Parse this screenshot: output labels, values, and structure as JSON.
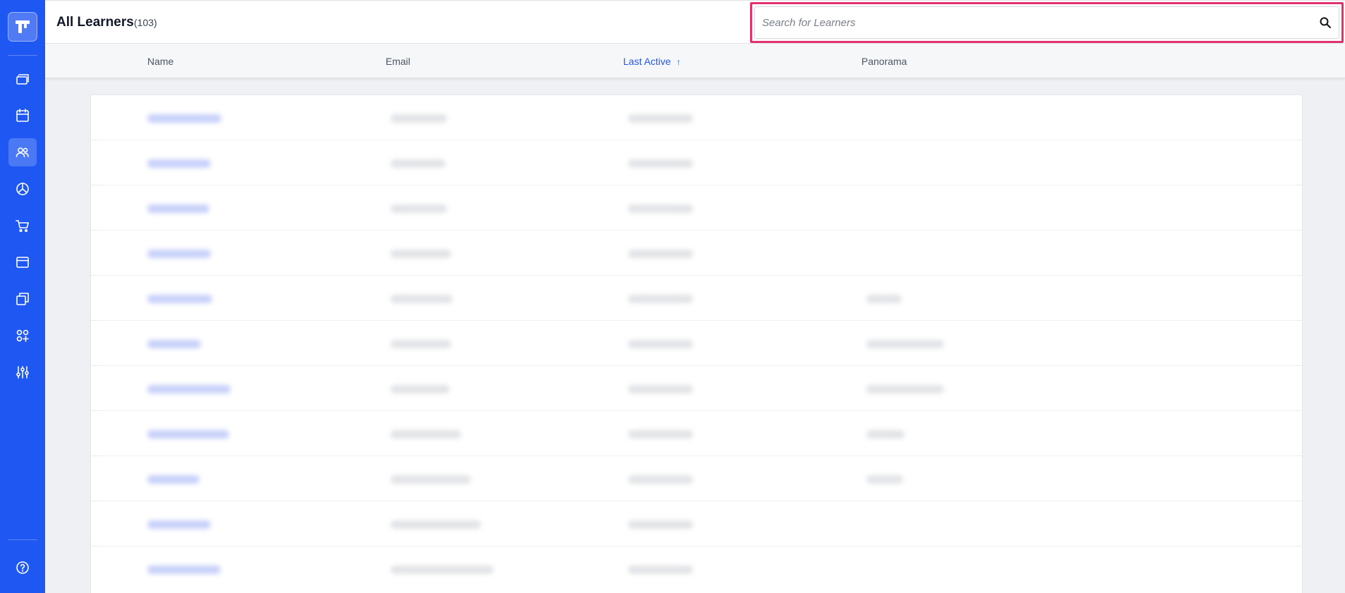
{
  "sidebar": {
    "logo_icon": "app-logo-icon",
    "items": [
      {
        "icon": "courses-icon"
      },
      {
        "icon": "calendar-icon"
      },
      {
        "icon": "users-icon",
        "active": true
      },
      {
        "icon": "pie-chart-icon"
      },
      {
        "icon": "cart-icon"
      },
      {
        "icon": "browser-window-icon"
      },
      {
        "icon": "copy-stack-icon"
      },
      {
        "icon": "apps-add-icon"
      },
      {
        "icon": "sliders-icon"
      }
    ],
    "help_icon": "help-circle-icon"
  },
  "header": {
    "title": "All Learners",
    "count": "(103)",
    "search": {
      "placeholder": "Search for Learners",
      "value": ""
    },
    "settings_icon": "gear-icon"
  },
  "table": {
    "columns": [
      {
        "label": "Name",
        "sorted": false
      },
      {
        "label": "Email",
        "sorted": false
      },
      {
        "label": "Last Active",
        "sorted": true,
        "sort_direction": "ascending"
      },
      {
        "label": "Panorama",
        "sorted": false
      }
    ],
    "sort_arrow": "↑",
    "rows_blurred": 11
  },
  "colors": {
    "accent": "#1f57f2",
    "highlight": "#e0336e",
    "background": "#eef0f3"
  }
}
